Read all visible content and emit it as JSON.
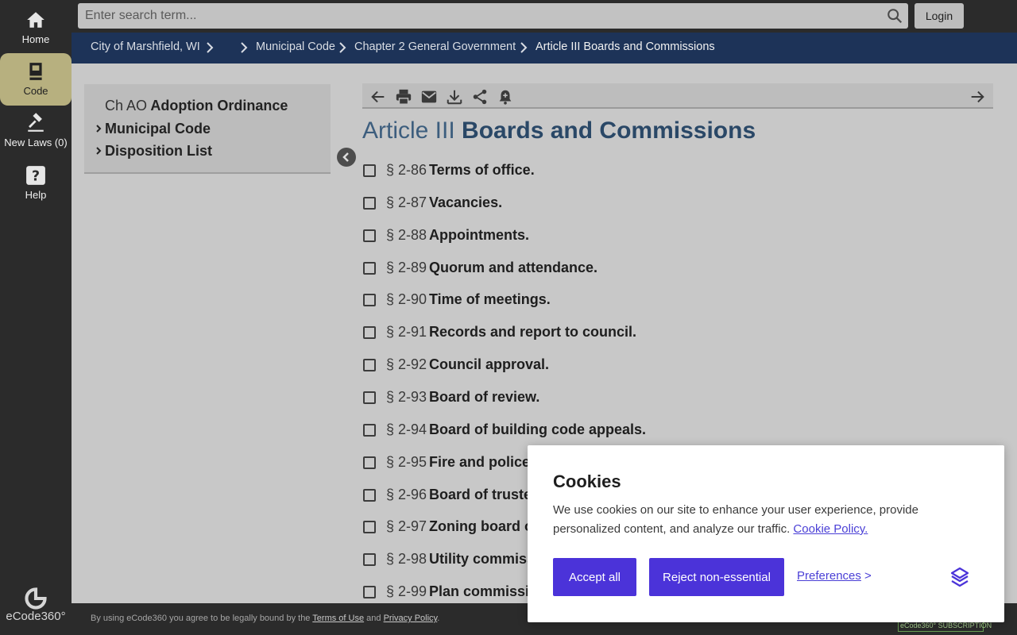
{
  "nav": {
    "items": [
      {
        "label": "Home",
        "icon": "home-icon"
      },
      {
        "label": "Code",
        "icon": "book-icon"
      },
      {
        "label": "New Laws (0)",
        "icon": "gavel-icon"
      },
      {
        "label": "Help",
        "icon": "help-icon"
      }
    ],
    "logo": "eCode360°"
  },
  "search": {
    "placeholder": "Enter search term..."
  },
  "login_label": "Login",
  "breadcrumb": [
    "City of Marshfield, WI",
    "Municipal Code",
    "Chapter 2 General Government",
    "Article III Boards and Commissions"
  ],
  "toc": {
    "row1_prefix": "Ch AO",
    "row1_title": "Adoption Ordinance",
    "row2": "Municipal Code",
    "row3": "Disposition List"
  },
  "heading": {
    "number": "Article III",
    "title": "Boards and Commissions"
  },
  "sections": [
    {
      "num": "§ 2-86",
      "title": "Terms of office."
    },
    {
      "num": "§ 2-87",
      "title": "Vacancies."
    },
    {
      "num": "§ 2-88",
      "title": "Appointments."
    },
    {
      "num": "§ 2-89",
      "title": "Quorum and attendance."
    },
    {
      "num": "§ 2-90",
      "title": "Time of meetings."
    },
    {
      "num": "§ 2-91",
      "title": "Records and report to council."
    },
    {
      "num": "§ 2-92",
      "title": "Council approval."
    },
    {
      "num": "§ 2-93",
      "title": "Board of review."
    },
    {
      "num": "§ 2-94",
      "title": "Board of building code appeals."
    },
    {
      "num": "§ 2-95",
      "title": "Fire and police"
    },
    {
      "num": "§ 2-96",
      "title": "Board of truste"
    },
    {
      "num": "§ 2-97",
      "title": "Zoning board o"
    },
    {
      "num": "§ 2-98",
      "title": "Utility commiss"
    },
    {
      "num": "§ 2-99",
      "title": "Plan commissio"
    }
  ],
  "footer": {
    "pre": "By using eCode360 you agree to be legally bound by the",
    "terms": "Terms of Use",
    "and": "and",
    "privacy": "Privacy Policy",
    "badge": "eCode360° SUBSCRIPTION"
  },
  "cookie": {
    "title": "Cookies",
    "body": "We use cookies on our site to enhance your user experience, provide personalized content, and analyze our traffic.",
    "policy_link": "Cookie Policy.",
    "accept": "Accept all",
    "reject": "Reject non-essential",
    "preferences": "Preferences",
    "pref_arrow": ">"
  },
  "colors": {
    "brand_nav": "#1d3358",
    "accent": "#4b33d9",
    "active_tab": "#b7b07f"
  }
}
